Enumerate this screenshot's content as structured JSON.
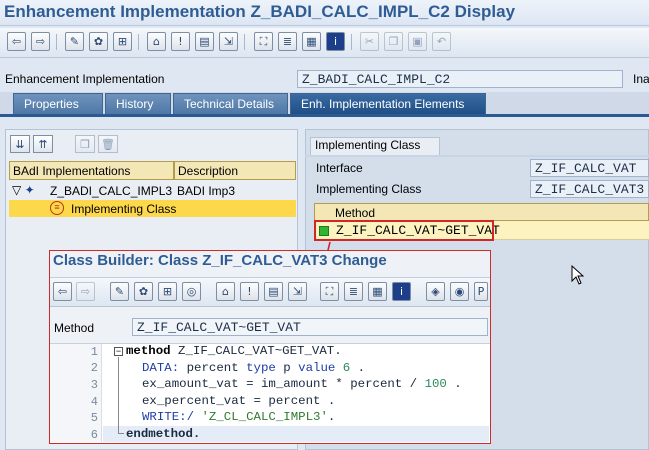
{
  "window": {
    "title": "Enhancement Implementation Z_BADI_CALC_IMPL_C2 Display"
  },
  "header": {
    "field_label": "Enhancement Implementation",
    "field_value": "Z_BADI_CALC_IMPL_C2",
    "right_label": "Ina"
  },
  "tabs": [
    {
      "label": "Properties"
    },
    {
      "label": "History"
    },
    {
      "label": "Technical Details"
    },
    {
      "label": "Enh. Implementation Elements"
    }
  ],
  "tree": {
    "col_impl": "BAdI Implementations",
    "col_desc": "Description",
    "rows": [
      {
        "name": "Z_BADI_CALC_IMPL3",
        "desc": "BADI Imp3"
      },
      {
        "name": "Implementing Class",
        "desc": ""
      }
    ]
  },
  "impl_class": {
    "title": "Implementing Class",
    "interface_label": "Interface",
    "interface_value": "Z_IF_CALC_VAT",
    "class_label": "Implementing Class",
    "class_value": "Z_IF_CALC_VAT3",
    "method_header": "Method",
    "method_value": "Z_IF_CALC_VAT~GET_VAT"
  },
  "class_builder": {
    "title": "Class Builder: Class Z_IF_CALC_VAT3 Change",
    "method_label": "Method",
    "method_value": "Z_IF_CALC_VAT~GET_VAT",
    "line_numbers": [
      "1",
      "2",
      "3",
      "4",
      "5",
      "6"
    ],
    "code": {
      "l1_kw": "method",
      "l1_rest": " Z_IF_CALC_VAT~GET_VAT.",
      "l2_kw": "DATA:",
      "l2_a": " percent ",
      "l2_kw2": "type",
      "l2_b": " p ",
      "l2_kw3": "value",
      "l2_num": " 6",
      "l2_end": " .",
      "l3_a": "ex_amount_vat = im_amount * percent / ",
      "l3_num": "100",
      "l3_end": " .",
      "l4": "ex_percent_vat = percent .",
      "l5_kw": "WRITE:/",
      "l5_str": " 'Z_CL_CALC_IMPL3'",
      "l5_end": ".",
      "l6_kw": "endmethod."
    }
  },
  "icons": {
    "main_toolbar": [
      "back-icon",
      "forward-icon",
      "display-change-icon",
      "activate-icon",
      "object-list-icon",
      "where-used-icon",
      "information-icon",
      "other-object-icon",
      "navigate-icon",
      "hierarchy-icon",
      "layout-icon",
      "display-object-list-icon",
      "info-icon",
      "cut-icon",
      "copy-icon",
      "paste-icon",
      "undo-icon"
    ],
    "colors": {
      "title": "#2f5d93",
      "highlight": "#d02828",
      "status_green": "#2fb52f"
    }
  }
}
